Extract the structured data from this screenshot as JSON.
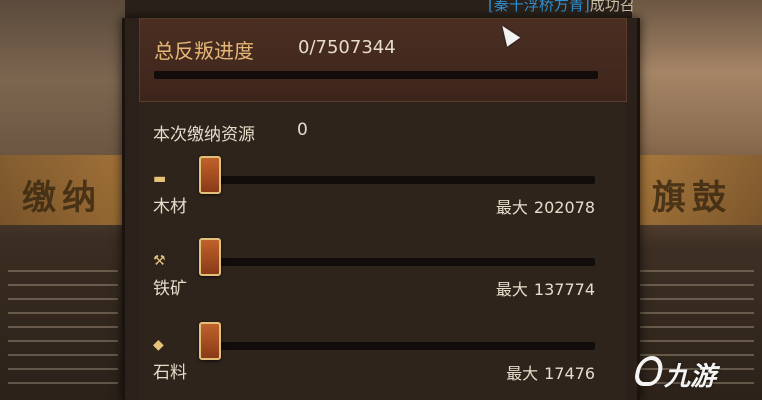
{
  "background": {
    "banner_left": "缴纳",
    "banner_right": "旗鼓"
  },
  "top_notice": {
    "highlight": "[秦十浮桥方青]",
    "suffix": "成功召"
  },
  "progress": {
    "label": "总反叛进度",
    "value_text": "0/7507344",
    "fraction": 0
  },
  "paid": {
    "label": "本次缴纳资源",
    "value": "0"
  },
  "resources": [
    {
      "icon": "wood-icon",
      "name": "木材",
      "max_label": "最大",
      "max_value": "202078",
      "slider_value": 0
    },
    {
      "icon": "iron-ore-icon",
      "name": "铁矿",
      "max_label": "最大",
      "max_value": "137774",
      "slider_value": 0
    },
    {
      "icon": "stone-icon",
      "name": "石料",
      "max_label": "最大",
      "max_value": "17476",
      "slider_value": 0
    }
  ],
  "watermark": {
    "text": "九游"
  }
}
